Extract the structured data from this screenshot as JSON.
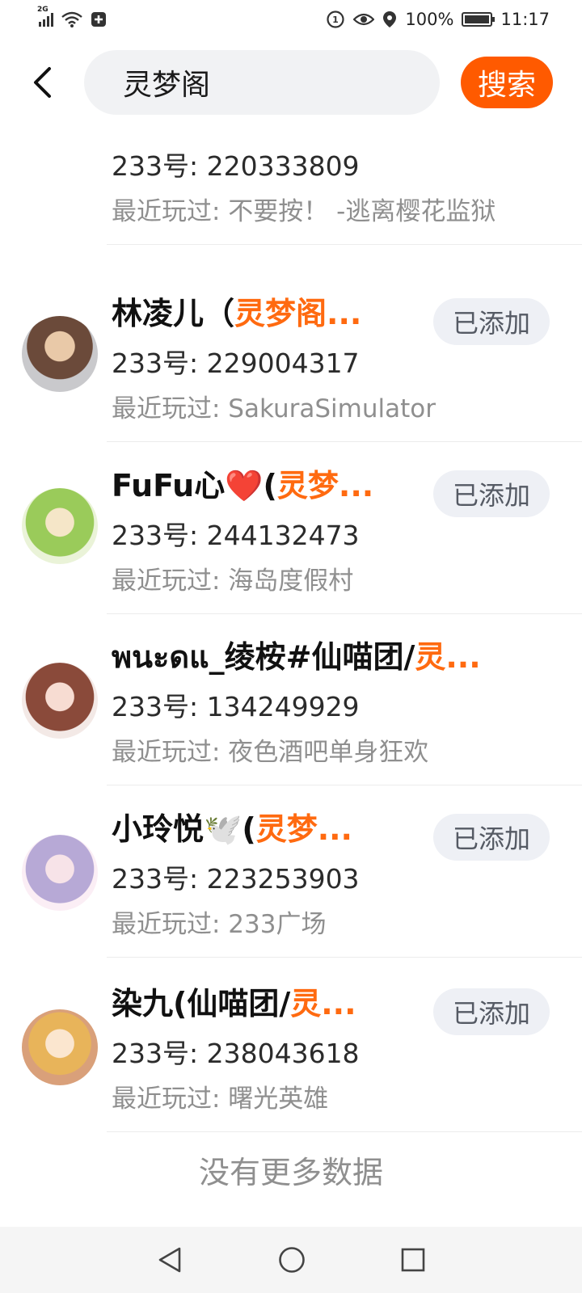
{
  "status_bar": {
    "network": "2G",
    "battery_level": 1.0,
    "battery_text": "100%",
    "time": "11:17"
  },
  "search": {
    "query": "灵梦阁",
    "button_label": "搜索"
  },
  "highlight_color": "#ff6a10",
  "accent_color": "#ff5a00",
  "results": [
    {
      "name_prefix": "",
      "name_highlight": "",
      "uid": "233号: 220333809",
      "played": "最近玩过: 不要按！ -逃离樱花监狱",
      "button": ""
    },
    {
      "name_prefix": "林凌儿（",
      "name_highlight": "灵梦阁...",
      "uid": "233号: 229004317",
      "played": "最近玩过: SakuraSimulator",
      "button": "已添加"
    },
    {
      "name_prefix": "FuFu心❤️(",
      "name_highlight": "灵梦...",
      "uid": "233号: 244132473",
      "played": "最近玩过: 海岛度假村",
      "button": "已添加"
    },
    {
      "name_prefix": "พนะดแ_绫桉#仙喵团/",
      "name_highlight": "灵...",
      "uid": "233号: 134249929",
      "played": "最近玩过: 夜色酒吧单身狂欢",
      "button": ""
    },
    {
      "name_prefix": "小玲悦🕊️(",
      "name_highlight": "灵梦...",
      "uid": "233号: 223253903",
      "played": "最近玩过: 233广场",
      "button": "已添加"
    },
    {
      "name_prefix": "染九(仙喵团/",
      "name_highlight": "灵...",
      "uid": "233号: 238043618",
      "played": "最近玩过: 曙光英雄",
      "button": "已添加"
    }
  ],
  "footer": "没有更多数据"
}
